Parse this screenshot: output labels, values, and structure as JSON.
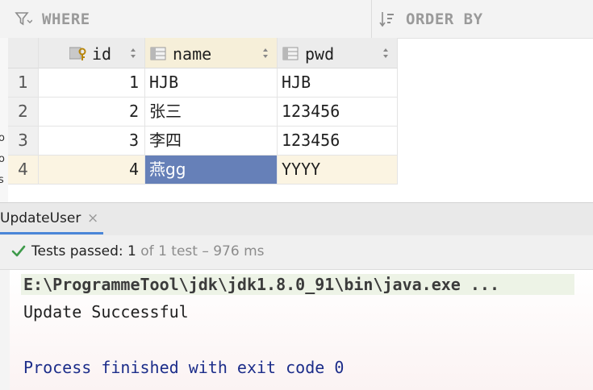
{
  "filter": {
    "where_label": "WHERE",
    "order_label": "ORDER BY",
    "where_icon": "filter-funnel-icon",
    "order_icon": "sort-order-icon"
  },
  "gutter_fragments": [
    "o",
    "o",
    "s"
  ],
  "grid": {
    "columns": [
      {
        "label": "id",
        "icon": "primary-key-column-icon"
      },
      {
        "label": "name",
        "icon": "column-icon"
      },
      {
        "label": "pwd",
        "icon": "column-icon"
      }
    ],
    "rows": [
      {
        "num": "1",
        "id": "1",
        "name": "HJB",
        "pwd": "HJB"
      },
      {
        "num": "2",
        "id": "2",
        "name": "张三",
        "pwd": "123456"
      },
      {
        "num": "3",
        "id": "3",
        "name": "李四",
        "pwd": "123456"
      },
      {
        "num": "4",
        "id": "4",
        "name": "燕gg",
        "pwd": "YYYY"
      }
    ],
    "selected_row": 4,
    "selected_cell": "name",
    "colors": {
      "selected_row_bg": "#fbf4e2",
      "selected_cell_bg": "#6680b8"
    }
  },
  "run": {
    "tab_title": "UpdateUser",
    "tab_close_glyph": "×",
    "status_check_icon": "check-icon",
    "status_prefix": "Tests passed: ",
    "status_count": "1",
    "status_suffix": " of 1 test – 976 ms"
  },
  "console": {
    "command": "E:\\ProgrammeTool\\jdk\\jdk1.8.0_91\\bin\\java.exe ...",
    "output": "Update Successful",
    "exit": "Process finished with exit code 0",
    "colors": {
      "exit_text": "#1c2d8a",
      "command_bg": "#edf3e6"
    }
  }
}
